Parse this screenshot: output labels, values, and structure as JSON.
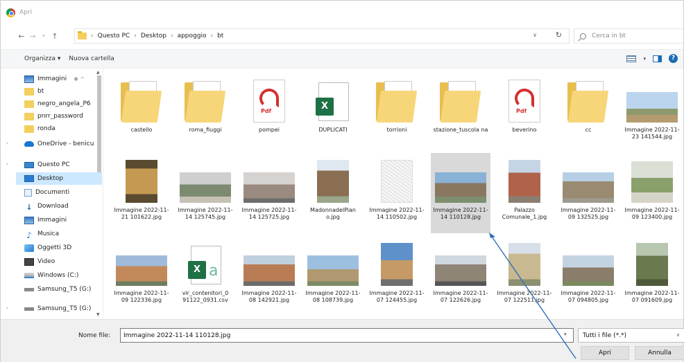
{
  "window": {
    "title": "Apri"
  },
  "nav": {
    "breadcrumb": [
      "Questo PC",
      "Desktop",
      "appoggio",
      "bt"
    ],
    "search_placeholder": "Cerca in bt"
  },
  "toolbar": {
    "organize": "Organizza ▾",
    "new_folder": "Nuova cartella"
  },
  "sidebar": {
    "items": [
      {
        "label": "Immagini",
        "icon": "pictures-icon",
        "pin": "✱ ^"
      },
      {
        "label": "bt",
        "icon": "folder-icon"
      },
      {
        "label": "negro_angela_P6",
        "icon": "folder-icon"
      },
      {
        "label": "pnrr_password",
        "icon": "folder-icon"
      },
      {
        "label": "ronda",
        "icon": "folder-icon"
      },
      {
        "label": "OneDrive - benicu",
        "icon": "onedrive-icon"
      },
      {
        "label": "Questo PC",
        "icon": "this-pc-icon"
      },
      {
        "label": "Desktop",
        "icon": "desktop-icon",
        "selected": true
      },
      {
        "label": "Documenti",
        "icon": "documents-icon"
      },
      {
        "label": "Download",
        "icon": "download-icon"
      },
      {
        "label": "Immagini",
        "icon": "pictures-icon"
      },
      {
        "label": "Musica",
        "icon": "music-icon"
      },
      {
        "label": "Oggetti 3D",
        "icon": "objects-3d-icon"
      },
      {
        "label": "Video",
        "icon": "video-icon"
      },
      {
        "label": "Windows (C:)",
        "icon": "drive-icon"
      },
      {
        "label": "Samsung_T5 (G:)",
        "icon": "usb-drive-icon"
      },
      {
        "label": "Samsung_T5 (G:)",
        "icon": "usb-drive-icon"
      }
    ]
  },
  "files": [
    {
      "name": "castello",
      "kind": "folder"
    },
    {
      "name": "roma_fiuggi",
      "kind": "folder"
    },
    {
      "name": "pompei",
      "kind": "pdf"
    },
    {
      "name": "DUPLICATI",
      "kind": "xls"
    },
    {
      "name": "torrioni",
      "kind": "folder"
    },
    {
      "name": "stazione_tuscola na",
      "kind": "folder"
    },
    {
      "name": "beverino",
      "kind": "pdf"
    },
    {
      "name": "cc",
      "kind": "folder"
    },
    {
      "name": "Immagine 2022-11-23 141544.jpg",
      "kind": "image"
    },
    {
      "name": "Immagine 2022-11-21 101622.jpg",
      "kind": "image"
    },
    {
      "name": "Immagine 2022-11-14 125745.jpg",
      "kind": "image"
    },
    {
      "name": "Immagine 2022-11-14 125725.jpg",
      "kind": "image"
    },
    {
      "name": "MadonnadelPian o.jpg",
      "kind": "image"
    },
    {
      "name": "Immagine 2022-11-14 110502.jpg",
      "kind": "image"
    },
    {
      "name": "Immagine 2022-11-14 110128.jpg",
      "kind": "image",
      "selected": true
    },
    {
      "name": "Palazzo Comunale_1.jpg",
      "kind": "image"
    },
    {
      "name": "Immagine 2022-11-09 132525.jpg",
      "kind": "image"
    },
    {
      "name": "Immagine 2022-11-09 123400.jpg",
      "kind": "image"
    },
    {
      "name": "Immagine 2022-11-09 122336.jpg",
      "kind": "image"
    },
    {
      "name": "vir_contenitori_0 91122_0931.csv",
      "kind": "csv"
    },
    {
      "name": "Immagine 2022-11-08 142921.jpg",
      "kind": "image"
    },
    {
      "name": "Immagine 2022-11-08 108739.jpg",
      "kind": "image"
    },
    {
      "name": "Immagine 2022-11-07 124455.jpg",
      "kind": "image"
    },
    {
      "name": "Immagine 2022-11-07 122626.jpg",
      "kind": "image"
    },
    {
      "name": "Immagine 2022-11-07 122511.jpg",
      "kind": "image"
    },
    {
      "name": "Immagine 2022-11-07 094805.jpg",
      "kind": "image"
    },
    {
      "name": "Immagine 2022-11-07 091609.jpg",
      "kind": "image"
    }
  ],
  "footer": {
    "filename_label": "Nome file:",
    "filename_value": "Immagine 2022-11-14 110128.jpg",
    "filetype": "Tutti i file (*.*)",
    "open": "Apri",
    "cancel": "Annulla"
  },
  "colors": {
    "selection": "#cce8ff",
    "annotation_arrow": "#2f6fb8"
  }
}
